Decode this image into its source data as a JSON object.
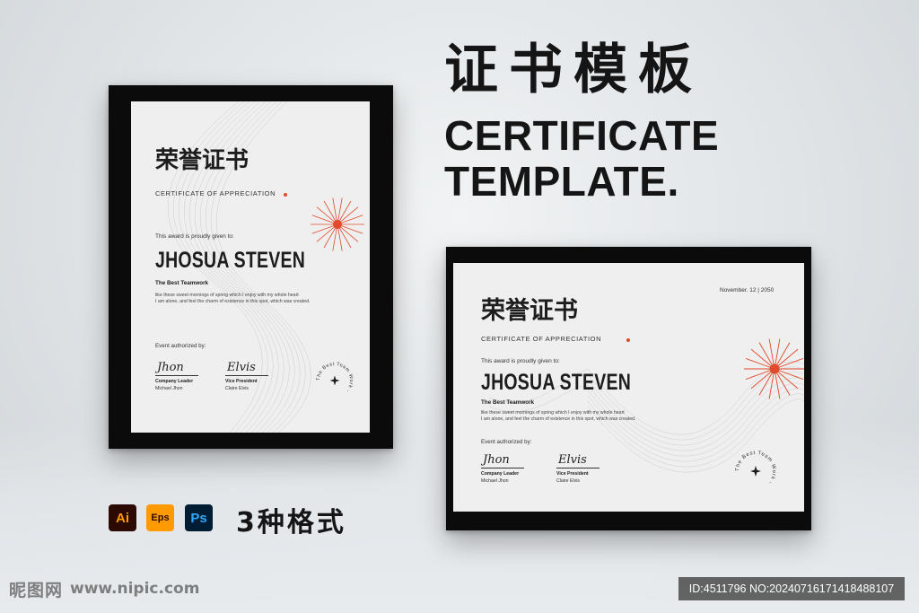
{
  "heading": {
    "cn": "证书模板",
    "en_line1": "CERTIFICATE",
    "en_line2": "TEMPLATE."
  },
  "certificate": {
    "title_cn": "荣誉证书",
    "subtitle": "CERTIFICATE OF APPRECIATION",
    "given_to": "This award is proudly given to:",
    "recipient": "JHOSUA STEVEN",
    "award": "The Best Teamwork",
    "body_line1": "like these sweet mornings of spring which I enjoy with my whole heart",
    "body_line2": "I am alone, and feel the charm of existence in this spot, which was created.",
    "authorized": "Event authorized by:",
    "signer1": {
      "signature": "Jhon",
      "role": "Company Leader",
      "name": "Michael Jhon"
    },
    "signer2": {
      "signature": "Elvis",
      "role": "Vice President",
      "name": "Claire Elvis"
    },
    "seal_text": "The Best Team Work -",
    "date": "November. 12 | 2050",
    "accent_color": "#e24a2d"
  },
  "formats": {
    "icons": [
      {
        "label": "Ai",
        "icon": "illustrator-icon",
        "bg": "#2c0a03",
        "fg": "#ff9a00"
      },
      {
        "label": "Eps",
        "icon": "eps-icon",
        "bg": "#ff9a00",
        "fg": "#2c0a03"
      },
      {
        "label": "Ps",
        "icon": "photoshop-icon",
        "bg": "#001d34",
        "fg": "#31a8ff"
      }
    ],
    "text": "3种格式"
  },
  "watermark": {
    "site_name": "昵图网",
    "site_url": "www.nipic.com",
    "id_text": "ID:4511796 NO:20240716171418488107"
  }
}
